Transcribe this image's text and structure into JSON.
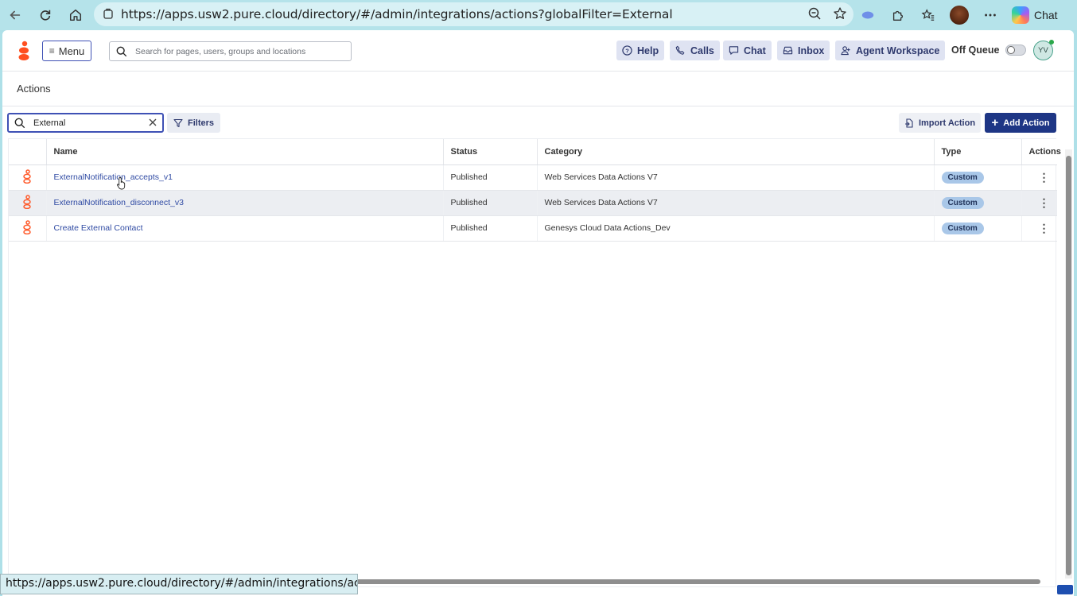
{
  "browser": {
    "url": "https://apps.usw2.pure.cloud/directory/#/admin/integrations/actions?globalFilter=External",
    "chat_label": "Chat"
  },
  "topnav": {
    "menu_label": "Menu",
    "search_placeholder": "Search for pages, users, groups and locations",
    "help_label": "Help",
    "calls_label": "Calls",
    "chat_label": "Chat",
    "inbox_label": "Inbox",
    "agent_workspace_label": "Agent Workspace",
    "off_queue_label": "Off Queue",
    "user_initials": "YV"
  },
  "page": {
    "title": "Actions"
  },
  "toolbar": {
    "filter_value": "External",
    "filters_label": "Filters",
    "import_label": "Import Action",
    "add_label": "Add Action"
  },
  "table": {
    "columns": [
      "Name",
      "Status",
      "Category",
      "Type",
      "Actions"
    ],
    "rows": [
      {
        "name": "ExternalNotification_accepts_v1",
        "status": "Published",
        "category": "Web Services Data Actions V7",
        "type": "Custom"
      },
      {
        "name": "ExternalNotification_disconnect_v3",
        "status": "Published",
        "category": "Web Services Data Actions V7",
        "type": "Custom"
      },
      {
        "name": "Create External Contact",
        "status": "Published",
        "category": "Genesys Cloud Data Actions_Dev",
        "type": "Custom"
      }
    ]
  },
  "status_bar": {
    "link_preview": "https://apps.usw2.pure.cloud/directory/#/admin/integrations/act..."
  },
  "colors": {
    "accent": "#1e3685",
    "brand": "#ff4f1f",
    "badge": "#a9c7e8"
  }
}
